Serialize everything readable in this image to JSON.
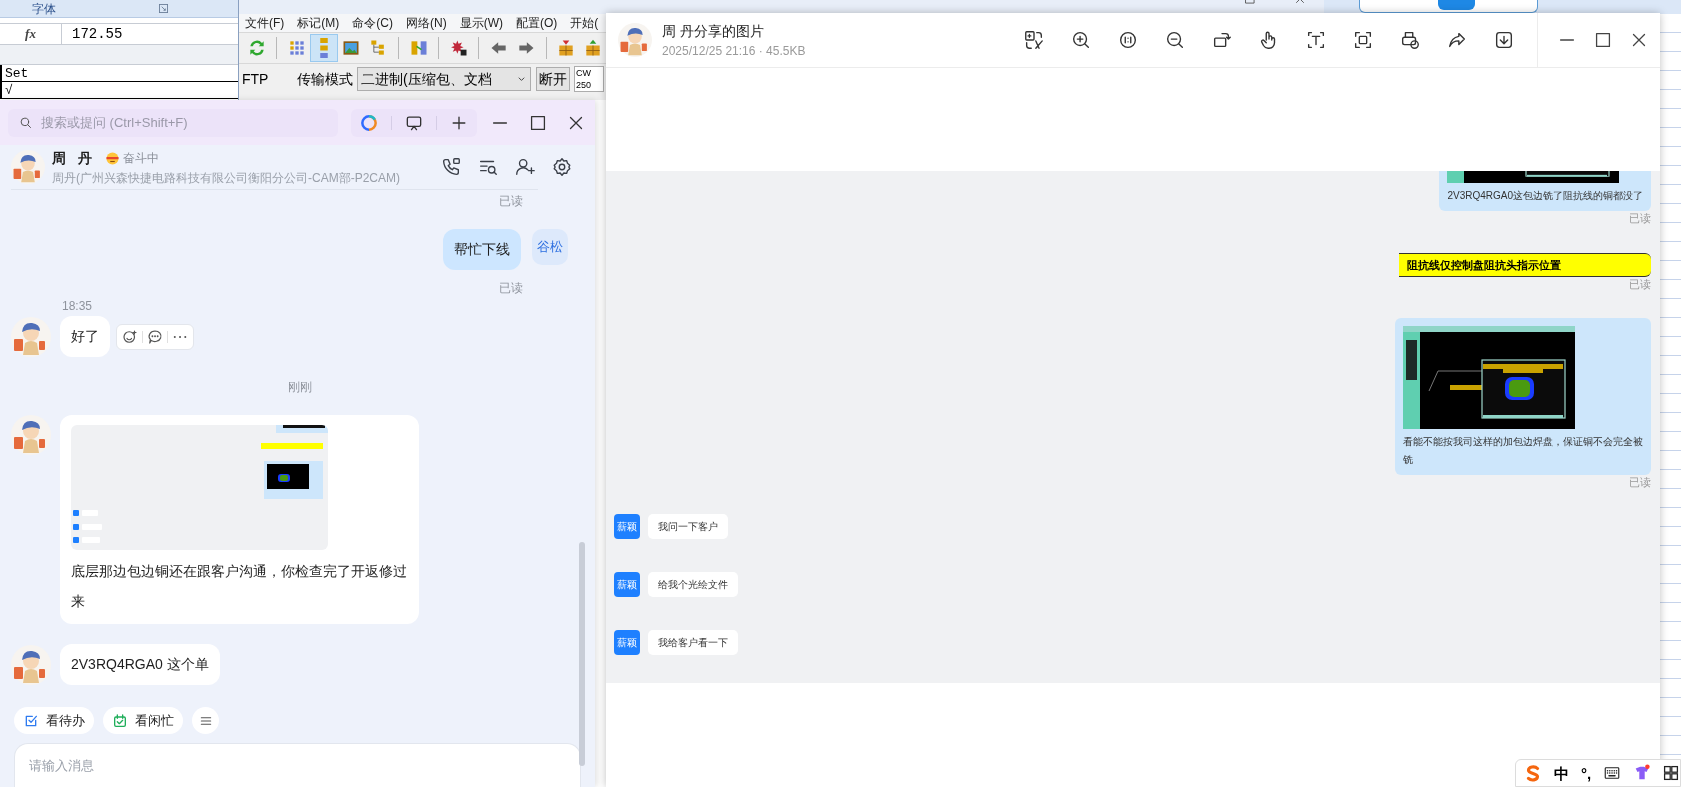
{
  "spreadsheet": {
    "ribbon_group": "字体",
    "function_label": "fx",
    "formula": "172.55",
    "cells": [
      "Set",
      "√"
    ]
  },
  "file_manager": {
    "menu": [
      "文件(F)",
      "标记(M)",
      "命令(C)",
      "网络(N)",
      "显示(W)",
      "配置(O)",
      "开始("
    ],
    "toolbar_groups": [
      [
        {
          "kind": "refresh",
          "selected": false
        }
      ],
      [
        {
          "kind": "brief",
          "selected": false
        },
        {
          "kind": "detail",
          "selected": true
        },
        {
          "kind": "thumbnails",
          "selected": false
        },
        {
          "kind": "tree",
          "selected": false
        }
      ],
      [
        {
          "kind": "sync",
          "selected": false
        }
      ],
      [
        {
          "kind": "star",
          "selected": false
        }
      ],
      [
        {
          "kind": "back",
          "selected": false
        },
        {
          "kind": "forward",
          "selected": false
        }
      ],
      [
        {
          "kind": "pack",
          "selected": false
        },
        {
          "kind": "unpack",
          "selected": false
        }
      ]
    ],
    "ftp": {
      "label": "FTP",
      "mode_label": "传输模式",
      "mode_value": "二进制(压缩包、文档",
      "disconnect": "断开",
      "info": [
        "CW",
        "250"
      ]
    }
  },
  "chat": {
    "search_placeholder": "搜索或提问 (Ctrl+Shift+F)",
    "title_tools": [
      {
        "kind": "assistant"
      },
      {
        "kind": "screen"
      },
      {
        "kind": "new"
      }
    ],
    "contact": {
      "name": "周 丹",
      "status": "奋斗中",
      "org": "周丹(广州兴森快捷电路科技有限公司衡阳分公司-CAM部-P2CAM)"
    },
    "header_tools": [
      {
        "kind": "call"
      },
      {
        "kind": "history"
      },
      {
        "kind": "add_member"
      },
      {
        "kind": "settings"
      }
    ],
    "messages": [
      {
        "kind": "receipt",
        "text": "已读"
      },
      {
        "kind": "outgoing",
        "text": "帮忙下线",
        "avatar": "谷松",
        "receipt": "已读"
      },
      {
        "kind": "incoming",
        "time": "18:35",
        "text": "好了",
        "actions": true
      },
      {
        "kind": "divider",
        "text": "刚刚"
      },
      {
        "kind": "image_text",
        "text": "底层那边包边铜还在跟客户沟通，你检查完了开返修过来"
      },
      {
        "kind": "incoming",
        "text": "2V3RQ4RGA0 这个单"
      }
    ],
    "quick_actions": [
      {
        "kind": "todo",
        "label": "看待办"
      },
      {
        "kind": "calendar",
        "label": "看闲忙"
      },
      {
        "kind": "more"
      }
    ],
    "input_placeholder": "请输入消息"
  },
  "viewer": {
    "title": "周 丹分享的图片",
    "meta": "2025/12/25 21:16 · 45.5KB",
    "tools": [
      {
        "kind": "translate"
      },
      {
        "kind": "zoom_in"
      },
      {
        "kind": "actual_size"
      },
      {
        "kind": "zoom_out"
      },
      {
        "kind": "rotate"
      },
      {
        "kind": "hand"
      },
      {
        "kind": "text"
      },
      {
        "kind": "scan"
      },
      {
        "kind": "print"
      },
      {
        "kind": "share"
      },
      {
        "kind": "download"
      }
    ],
    "image": {
      "items": [
        {
          "kind": "image_bubble",
          "text": "2V3RQ4RGA0这包边铣了阻抗线的铜都没了",
          "receipt": "已读"
        },
        {
          "kind": "banner",
          "text": "阻抗线仅控制盘阻抗头指示位置",
          "receipt": "已读"
        },
        {
          "kind": "image_bubble",
          "text": "看能不能按我司这样的加包边焊盘，保证铜不会完全被铣",
          "receipt": "已读"
        },
        {
          "kind": "incoming",
          "sender": "薪颖",
          "text": "我问一下客户"
        },
        {
          "kind": "incoming",
          "sender": "薪颖",
          "text": "给我个光绘文件"
        },
        {
          "kind": "incoming",
          "sender": "薪颖",
          "text": "我给客户看一下"
        }
      ]
    }
  },
  "ime": {
    "items": [
      {
        "kind": "logo"
      },
      {
        "kind": "text",
        "label": "中"
      },
      {
        "kind": "text",
        "label": "°,"
      },
      {
        "kind": "keyboard"
      },
      {
        "kind": "skin"
      },
      {
        "kind": "grid"
      }
    ]
  }
}
